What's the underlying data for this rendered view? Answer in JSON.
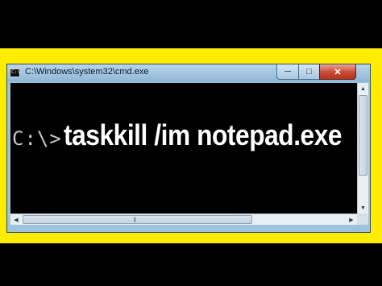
{
  "window": {
    "title": "C:\\Windows\\system32\\cmd.exe",
    "icon": "cmd-app-icon",
    "icon_prompt": "C:\\",
    "buttons": {
      "minimize_icon": "minimize-icon",
      "maximize_icon": "maximize-icon",
      "close_icon": "close-icon"
    }
  },
  "console": {
    "prompt": "C:\\>",
    "command": "taskkill /im notepad.exe",
    "background": "#000000",
    "prompt_color": "#c8c8c8",
    "text_color": "#ffffff"
  },
  "frame_color": "#ffec00",
  "scrollbars": {
    "vertical": {
      "up_icon": "scroll-up-arrow-icon",
      "down_icon": "scroll-down-arrow-icon"
    },
    "horizontal": {
      "left_icon": "scroll-left-arrow-icon",
      "right_icon": "scroll-right-arrow-icon"
    }
  }
}
